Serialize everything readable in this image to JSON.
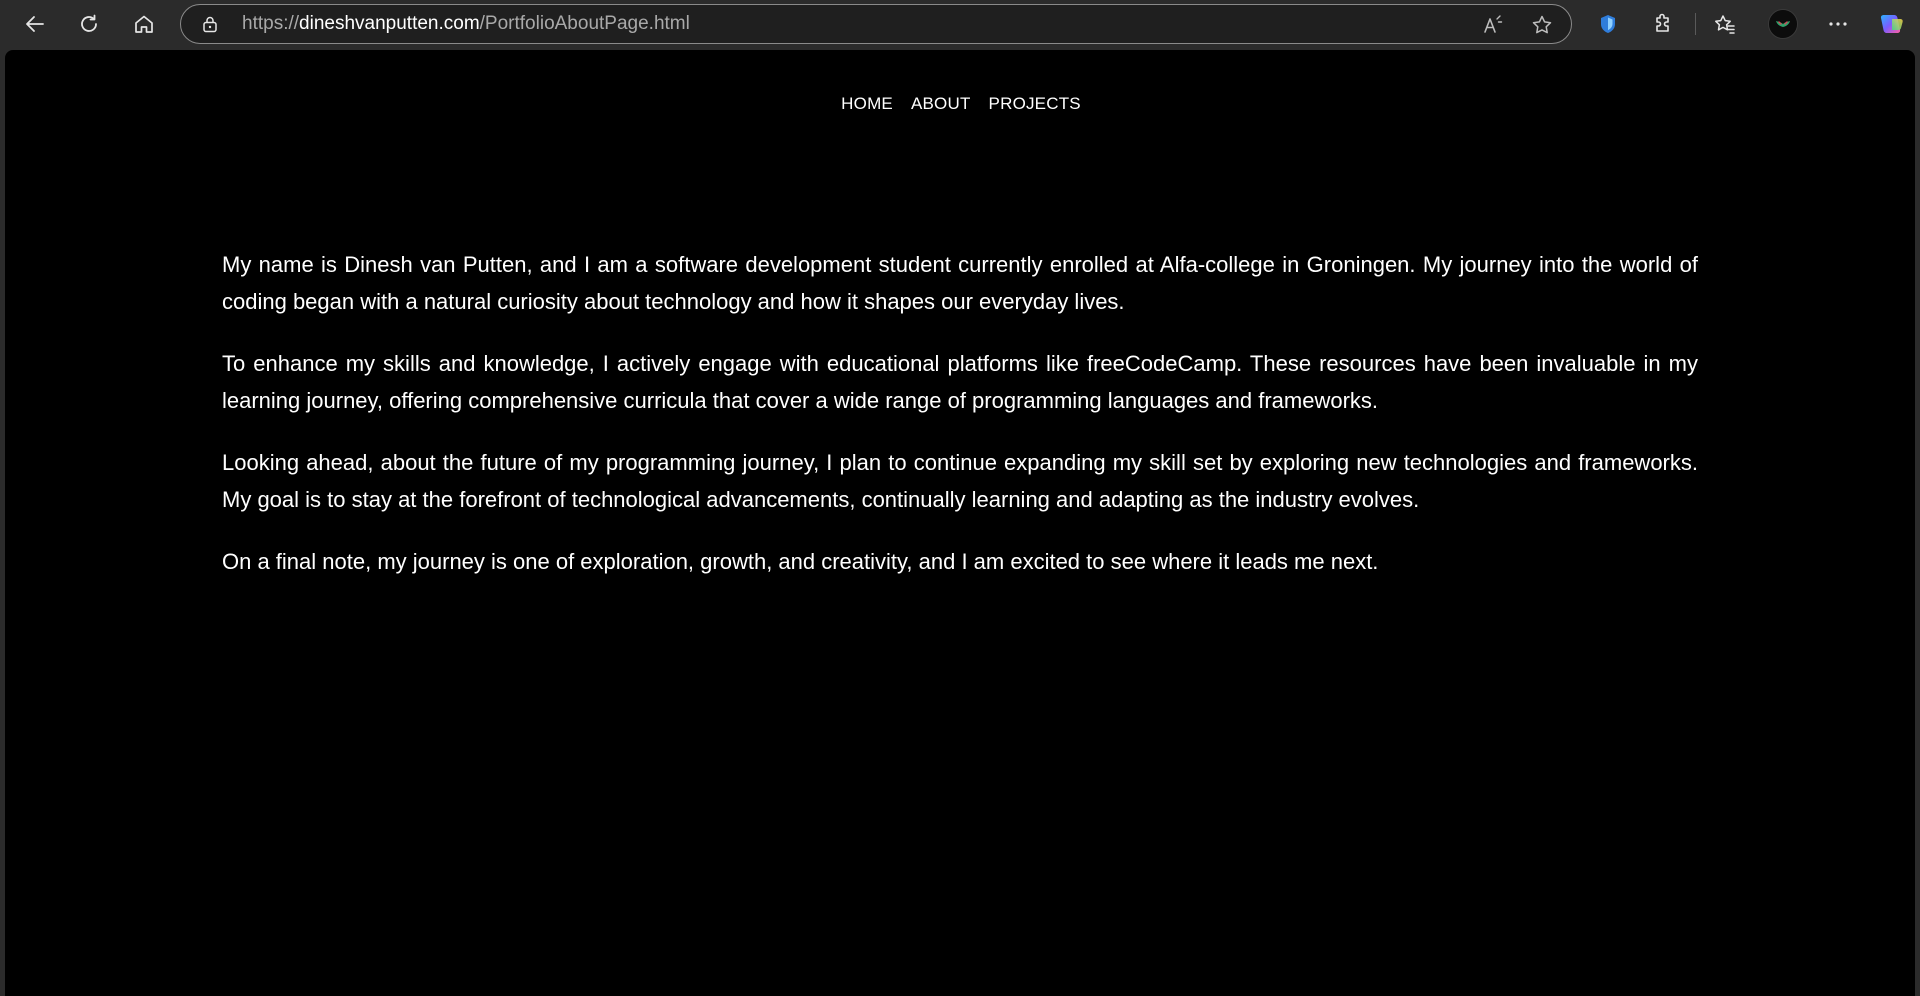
{
  "browser": {
    "url_prefix": "https://",
    "url_host": "dineshvanputten.com",
    "url_path": "/PortfolioAboutPage.html",
    "icons": [
      "back-icon",
      "refresh-icon",
      "home-icon",
      "lock-icon",
      "read-aloud-icon",
      "favorite-star-icon",
      "browser-essentials-icon",
      "extensions-icon",
      "favorites-icon",
      "profile-avatar",
      "more-menu-icon",
      "copilot-icon"
    ]
  },
  "nav": {
    "home": "HOME",
    "about": "ABOUT",
    "projects": "PROJECTS"
  },
  "about": {
    "paragraphs": [
      "My name is Dinesh van Putten, and I am a software development student currently enrolled at Alfa-college in Groningen. My journey into the world of coding began with a natural curiosity about technology and how it shapes our everyday lives.",
      "To enhance my skills and knowledge, I actively engage with educational platforms like freeCodeCamp. These resources have been invaluable in my learning journey, offering comprehensive curricula that cover a wide range of programming languages and frameworks.",
      "Looking ahead, about the future of my programming journey, I plan to continue expanding my skill set by exploring new technologies and frameworks. My goal is to stay at the forefront of technological advancements, continually learning and adapting as the industry evolves.",
      "On a final note, my journey is one of exploration, growth, and creativity, and I am excited to see where it leads me next."
    ]
  },
  "colors": {
    "page_background": "#000000",
    "text": "#ffffff",
    "browser_chrome": "#2b2b2b"
  }
}
